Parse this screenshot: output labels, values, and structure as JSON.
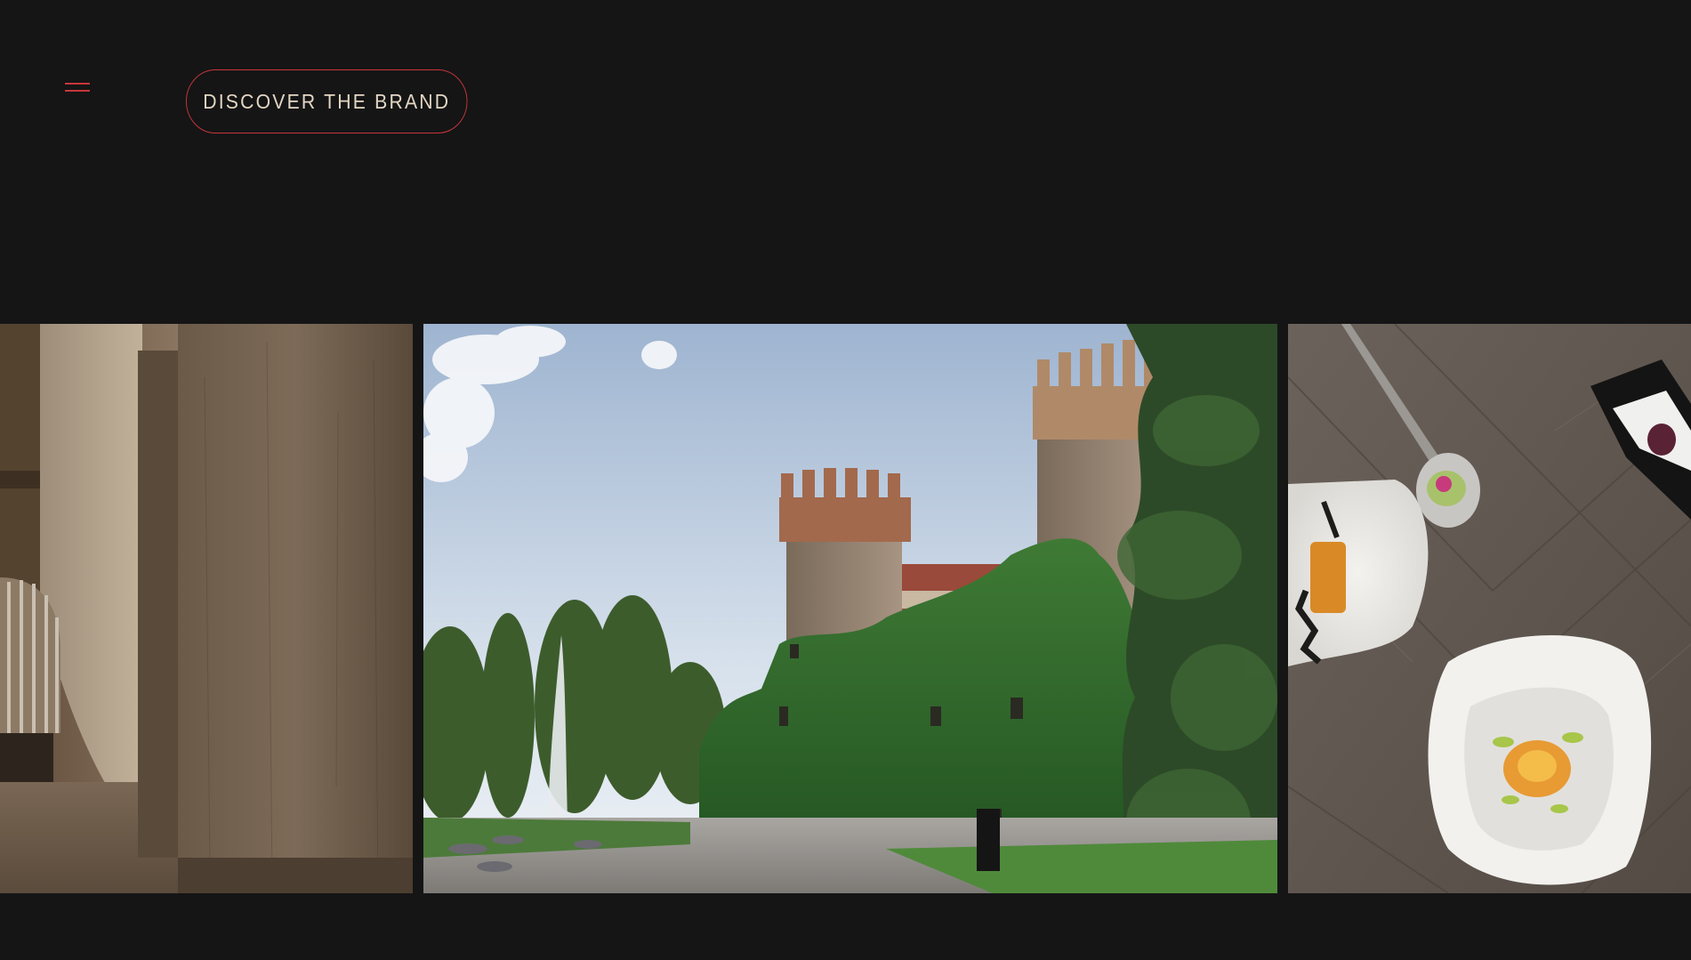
{
  "header": {
    "menu_icon": "hamburger-menu-icon",
    "discover_button_label": "DISCOVER THE BRAND"
  },
  "gallery": {
    "slides": [
      {
        "subject": "cellar-interior"
      },
      {
        "subject": "ivy-covered-castle"
      },
      {
        "subject": "plated-dishes"
      }
    ]
  },
  "colors": {
    "background": "#151516",
    "accent": "#c8363a",
    "button_text": "#e3d6c3"
  }
}
